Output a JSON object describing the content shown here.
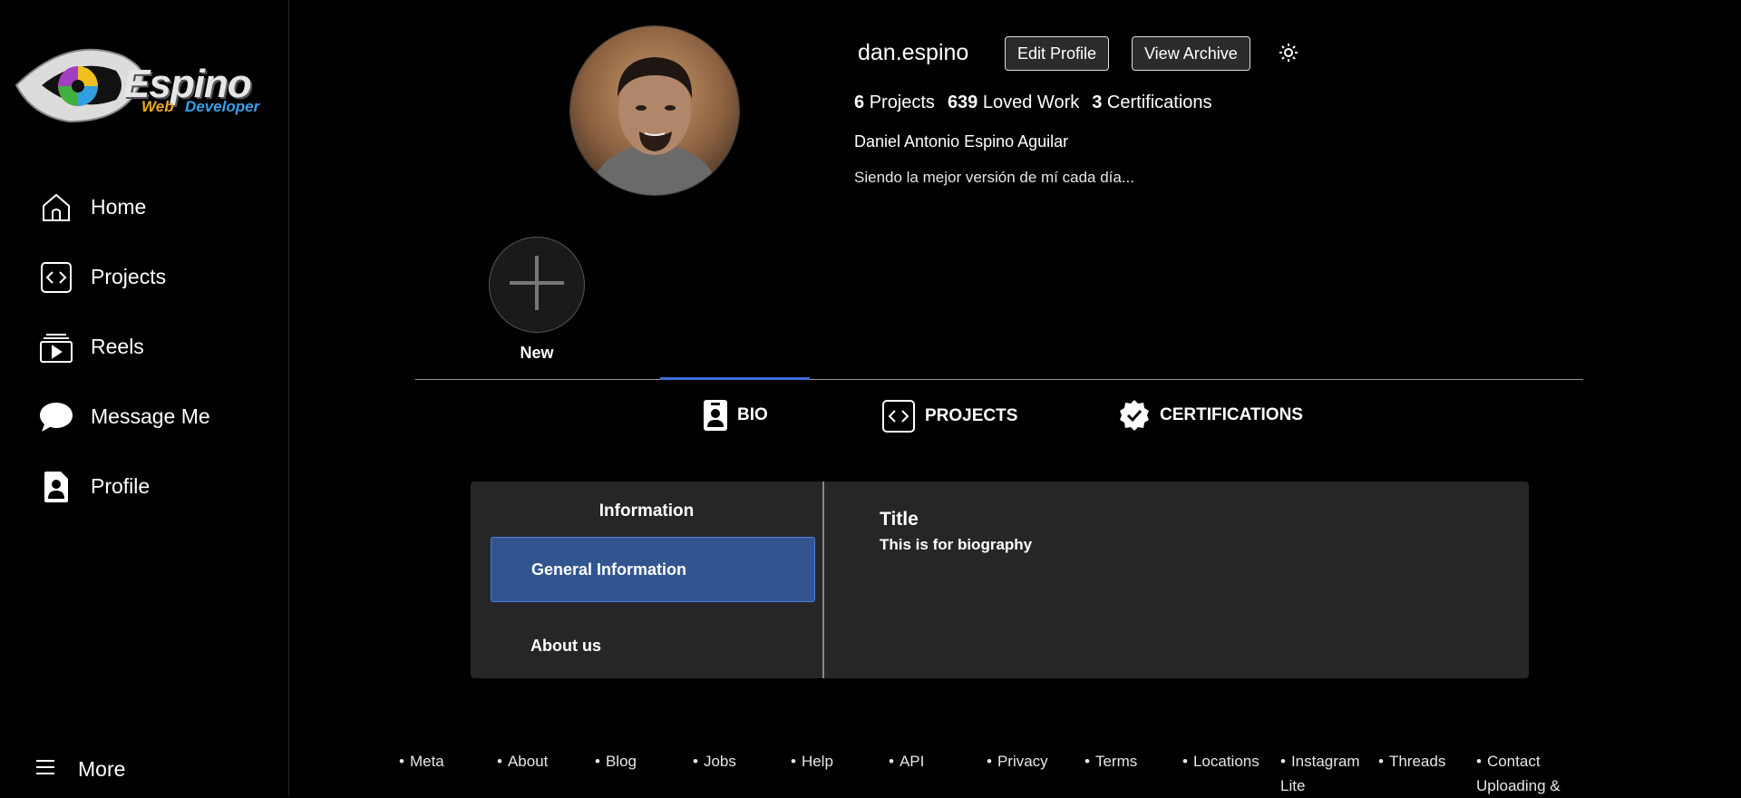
{
  "logo": {
    "main": "Espino",
    "sub1": "Web",
    "sub2": "Developer"
  },
  "nav": {
    "items": [
      {
        "label": "Home",
        "icon": "home-icon"
      },
      {
        "label": "Projects",
        "icon": "code-icon"
      },
      {
        "label": "Reels",
        "icon": "reels-icon"
      },
      {
        "label": "Message Me",
        "icon": "chat-bubble-icon"
      },
      {
        "label": "Profile",
        "icon": "profile-card-icon"
      }
    ],
    "more": "More"
  },
  "profile": {
    "username": "dan.espino",
    "edit_label": "Edit Profile",
    "archive_label": "View Archive",
    "stats": {
      "projects_count": "6",
      "projects_label": "Projects",
      "loved_count": "639",
      "loved_label": "Loved Work",
      "certs_count": "3",
      "certs_label": "Certifications"
    },
    "full_name": "Daniel Antonio Espino Aguilar",
    "tagline": "Siendo la mejor versión de mí cada día..."
  },
  "highlight": {
    "new_label": "New"
  },
  "tabs": [
    {
      "label": "BIO",
      "active": true
    },
    {
      "label": "PROJECTS",
      "active": false
    },
    {
      "label": "CERTIFICATIONS",
      "active": false
    }
  ],
  "bio_panel": {
    "heading": "Information",
    "menu": [
      "General Information",
      "About us"
    ],
    "selected": "General Information",
    "title": "Title",
    "description": "This is for biography"
  },
  "footer": {
    "links": [
      "Meta",
      "About",
      "Blog",
      "Jobs",
      "Help",
      "API",
      "Privacy",
      "Terms",
      "Locations",
      "Instagram Lite",
      "Threads",
      "Contact Uploading &"
    ]
  },
  "colors": {
    "background": "#000000",
    "panel": "#262629",
    "accent": "#3b6fd6",
    "selected": "#32558f"
  }
}
